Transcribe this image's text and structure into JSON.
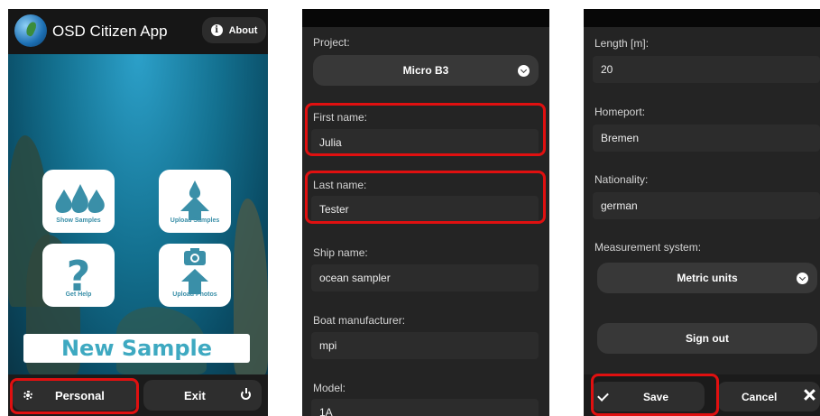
{
  "home": {
    "app_title": "OSD Citizen App",
    "about_label": "About",
    "tiles": {
      "show_samples": "Show Samples",
      "upload_samples": "Upload Samples",
      "get_help": "Get Help",
      "upload_photos": "Upload Photos"
    },
    "new_sample_label": "New Sample",
    "footer": {
      "personal_label": "Personal",
      "exit_label": "Exit"
    }
  },
  "personal": {
    "project": {
      "label": "Project:",
      "selected": "Micro B3"
    },
    "first_name": {
      "label": "First name:",
      "value": "Julia"
    },
    "last_name": {
      "label": "Last name:",
      "value": "Tester"
    },
    "ship_name": {
      "label": "Ship name:",
      "value": "ocean sampler"
    },
    "boat_manufacturer": {
      "label": "Boat manufacturer:",
      "value": "mpi"
    },
    "model": {
      "label": "Model:",
      "value": "1A"
    }
  },
  "settings": {
    "length": {
      "label": "Length [m]:",
      "value": "20"
    },
    "homeport": {
      "label": "Homeport:",
      "value": "Bremen"
    },
    "nationality": {
      "label": "Nationality:",
      "value": "german"
    },
    "measurement_system": {
      "label": "Measurement system:",
      "selected": "Metric units"
    },
    "sign_out_label": "Sign out",
    "footer": {
      "save_label": "Save",
      "cancel_label": "Cancel"
    }
  },
  "colors": {
    "highlight": "#e01010",
    "tile_label": "#3a8fa8",
    "new_sample_text": "#3ea9c1",
    "panel_bg": "#242424"
  }
}
